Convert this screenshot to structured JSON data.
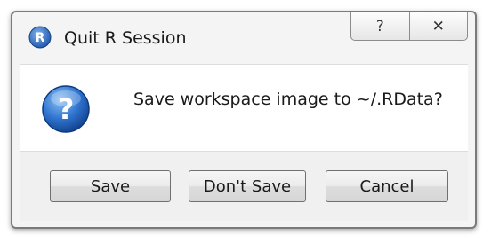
{
  "window": {
    "title": "Quit R Session",
    "app_icon_letter": "R",
    "help_glyph": "?",
    "close_glyph": "✕"
  },
  "dialog": {
    "message": "Save workspace image to ~/.RData?",
    "icon_glyph": "?"
  },
  "buttons": {
    "save_label": "Save",
    "dont_save_label": "Don't Save",
    "cancel_label": "Cancel"
  },
  "colors": {
    "question_icon_blue": "#1f5fb8",
    "r_logo_blue": "#2a6bc4"
  }
}
